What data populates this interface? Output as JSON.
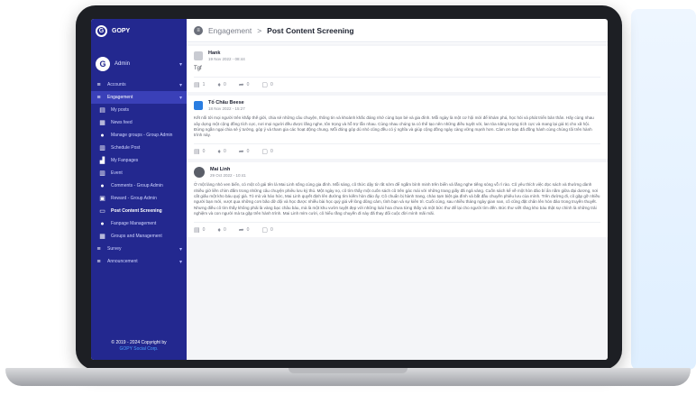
{
  "app": {
    "name": "GOPY",
    "logo_letter": "G"
  },
  "user": {
    "initial": "G",
    "name": "Admin"
  },
  "sidebar": {
    "items": [
      {
        "label": "Accounts",
        "icon": "list-icon",
        "glyph": "≡",
        "type": "group"
      },
      {
        "label": "Engagement",
        "icon": "list-icon",
        "glyph": "≡",
        "type": "active"
      },
      {
        "label": "My posts",
        "icon": "trash-icon",
        "glyph": "▤",
        "type": "sub"
      },
      {
        "label": "News feed",
        "icon": "newspaper-icon",
        "glyph": "▦",
        "type": "sub"
      },
      {
        "label": "Manage groups - Group Admin",
        "icon": "users-icon",
        "glyph": "●",
        "type": "sub"
      },
      {
        "label": "Schedule Post",
        "icon": "calendar-icon",
        "glyph": "▥",
        "type": "sub"
      },
      {
        "label": "My Fanpages",
        "icon": "chart-icon",
        "glyph": "▟",
        "type": "sub"
      },
      {
        "label": "Event",
        "icon": "calendar-icon",
        "glyph": "▥",
        "type": "sub"
      },
      {
        "label": "Comments - Group Admin",
        "icon": "users-icon",
        "glyph": "●",
        "type": "sub"
      },
      {
        "label": "Reward - Group Admin",
        "icon": "gift-icon",
        "glyph": "▣",
        "type": "sub"
      },
      {
        "label": "Post Content Screening",
        "icon": "monitor-icon",
        "glyph": "▭",
        "type": "highlight"
      },
      {
        "label": "Fanpage Management",
        "icon": "users-icon",
        "glyph": "●",
        "type": "sub"
      },
      {
        "label": "Groups and Management",
        "icon": "grid-icon",
        "glyph": "▦",
        "type": "sub"
      },
      {
        "label": "Survey",
        "icon": "list-icon",
        "glyph": "≡",
        "type": "group"
      },
      {
        "label": "Announcement",
        "icon": "list-icon",
        "glyph": "≡",
        "type": "group"
      }
    ],
    "footer_line1": "© 2019 - 2024 Copyright by",
    "footer_line2": "GOPY Social Corp."
  },
  "breadcrumb": {
    "parent": "Engagement",
    "separator": ">",
    "current": "Post Content Screening"
  },
  "posts": [
    {
      "author": "Hank",
      "date": "19 Nov 2022 - 08:44",
      "body": "Tgf",
      "short": true,
      "avatar": "placeholder",
      "actions": {
        "comments": "1",
        "likes": "0",
        "shares": "0",
        "views": "0"
      }
    },
    {
      "author": "Tố Châu Beese",
      "date": "18 Nov 2022 - 15:27",
      "body": "Kết nối tới mọi người trên khắp thế giới, chia sẻ những câu chuyện, thông tin và khoảnh khắc đáng nhớ cùng bạn bè và gia đình. Mỗi ngày là một cơ hội mới để khám phá, học hỏi và phát triển bản thân. Hãy cùng nhau xây dựng một cộng đồng tích cực, nơi mọi người đều được lắng nghe, tôn trọng và hỗ trợ lẫn nhau. Cùng nhau chúng ta có thể tạo nên những điều tuyệt vời, lan tỏa năng lượng tích cực và mang lại giá trị cho xã hội. Đừng ngần ngại chia sẻ ý tưởng, góp ý và tham gia các hoạt động chung. Mỗi đóng góp dù nhỏ cũng đều có ý nghĩa và giúp cộng đồng ngày càng vững mạnh hơn. Cảm ơn bạn đã đồng hành cùng chúng tôi trên hành trình này.",
      "short": false,
      "avatar": "blue",
      "actions": {
        "comments": "0",
        "likes": "0",
        "shares": "0",
        "views": "0"
      }
    },
    {
      "author": "Mai Linh",
      "date": "29 Oct 2022 - 10:41",
      "body": "Ở một làng nhỏ ven biển, có một cô gái tên là Mai Linh sống cùng gia đình. Mỗi sáng, cô thức dậy từ rất sớm để ngắm bình minh trên biển và lắng nghe tiếng sóng vỗ rì rào. Cô yêu thích việc đọc sách và thường dành nhiều giờ liền chìm đắm trong những câu chuyện phiêu lưu kỳ thú. Một ngày nọ, cô tìm thấy một cuốn sách cũ trên gác mái với những trang giấy đã ngả vàng. Cuốn sách kể về một hòn đảo bí ẩn nằm giữa đại dương, nơi cất giấu một kho báu quý giá. Tò mò và háo hức, Mai Linh quyết định lên đường tìm kiếm hòn đảo ấy. Cô chuẩn bị hành trang, chào tạm biệt gia đình và bắt đầu chuyến phiêu lưu của mình. Trên đường đi, cô gặp gỡ nhiều người bạn mới, vượt qua những cơn bão dữ dội và học được nhiều bài học quý giá về lòng dũng cảm, tình bạn và sự kiên trì. Cuối cùng, sau nhiều tháng ngày gian nan, cô cũng đặt chân lên hòn đảo trong truyền thuyết. Nhưng điều cô tìm thấy không phải là vàng bạc châu báu, mà là một khu vườn tuyệt đẹp với những loài hoa chưa từng thấy và một bức thư để lại cho người tìm đến. Bức thư viết rằng kho báu thật sự chính là những trải nghiệm và con người mà ta gặp trên hành trình. Mai Linh mỉm cười, cô hiểu rằng chuyến đi này đã thay đổi cuộc đời mình mãi mãi.",
      "short": false,
      "avatar": "photo",
      "actions": {
        "comments": "0",
        "likes": "0",
        "shares": "0",
        "views": "0"
      }
    }
  ],
  "colors": {
    "sidebar": "#23288f",
    "sidebar_active": "#3a40b8",
    "accent": "#2a7de1"
  }
}
